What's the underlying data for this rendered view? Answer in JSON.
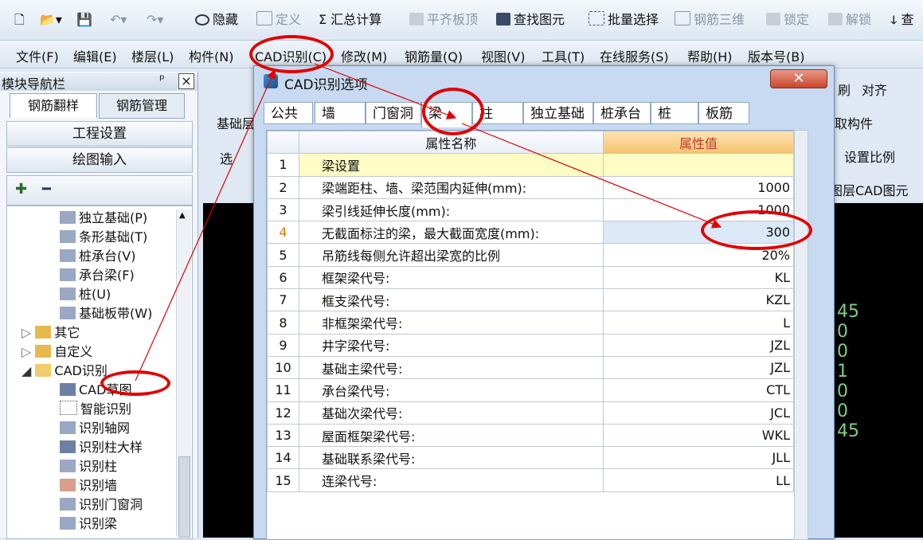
{
  "toolbar": {
    "hide_label": "隐藏",
    "define_label": "定义",
    "sum_label": "汇总计算",
    "align_top_label": "平齐板顶",
    "find_label": "查找图元",
    "batch_select_label": "批量选择",
    "rebar_3d_label": "钢筋三维",
    "lock_label": "锁定",
    "unlock_label": "解锁",
    "check_label": "查"
  },
  "menu": {
    "items": [
      "文件(F)",
      "编辑(E)",
      "楼层(L)",
      "构件(N)",
      "CAD识别(C)",
      "修改(M)",
      "钢筋量(Q)",
      "视图(V)",
      "工具(T)",
      "在线服务(S)",
      "帮助(H)",
      "版本号(B)"
    ]
  },
  "nav": {
    "title": "模块导航栏",
    "pin": "ᵖ",
    "close": "×",
    "tabs": [
      "钢筋翻样",
      "钢筋管理"
    ],
    "buttons": [
      "工程设置",
      "绘图输入"
    ],
    "expand": "✚",
    "collapse": "━",
    "tree": [
      {
        "label": "独立基础(P)"
      },
      {
        "label": "条形基础(T)"
      },
      {
        "label": "桩承台(V)"
      },
      {
        "label": "承台梁(F)"
      },
      {
        "label": "桩(U)"
      },
      {
        "label": "基础板带(W)"
      },
      {
        "label": "其它"
      },
      {
        "label": "自定义"
      },
      {
        "label": "CAD识别"
      },
      {
        "label": "CAD草图"
      },
      {
        "label": "智能识别"
      },
      {
        "label": "识别轴网"
      },
      {
        "label": "识别柱大样"
      },
      {
        "label": "识别柱"
      },
      {
        "label": "识别墙"
      },
      {
        "label": "识别门窗洞"
      },
      {
        "label": "识别梁"
      }
    ]
  },
  "background": {
    "right_labels": [
      "刷",
      "对齐",
      "取构件",
      "设置比例",
      "图层CAD图元"
    ],
    "left_labels": [
      "基础层",
      "选"
    ],
    "canvas_text": "45\n0\n0\n1\n0\n0\n45"
  },
  "dialog": {
    "title": "CAD识别选项",
    "close": "✕",
    "tabs": [
      "公共",
      "墙",
      "门窗洞",
      "梁",
      "柱",
      "独立基础",
      "桩承台",
      "桩",
      "板筋"
    ],
    "active_tab": "梁",
    "columns": {
      "name": "属性名称",
      "value": "属性值"
    },
    "rows": [
      {
        "num": "1",
        "name": "梁设置",
        "value": ""
      },
      {
        "num": "2",
        "name": "梁端距柱、墙、梁范围内延伸(mm):",
        "value": "1000"
      },
      {
        "num": "3",
        "name": "梁引线延伸长度(mm):",
        "value": "1000"
      },
      {
        "num": "4",
        "name": "无截面标注的梁，最大截面宽度(mm):",
        "value": "300"
      },
      {
        "num": "5",
        "name": "吊筋线每侧允许超出梁宽的比例",
        "value": "20%"
      },
      {
        "num": "6",
        "name": "框架梁代号:",
        "value": "KL"
      },
      {
        "num": "7",
        "name": "框支梁代号:",
        "value": "KZL"
      },
      {
        "num": "8",
        "name": "非框架梁代号:",
        "value": "L"
      },
      {
        "num": "9",
        "name": "井字梁代号:",
        "value": "JZL"
      },
      {
        "num": "10",
        "name": "基础主梁代号:",
        "value": "JZL"
      },
      {
        "num": "11",
        "name": "承台梁代号:",
        "value": "CTL"
      },
      {
        "num": "12",
        "name": "基础次梁代号:",
        "value": "JCL"
      },
      {
        "num": "13",
        "name": "屋面框架梁代号:",
        "value": "WKL"
      },
      {
        "num": "14",
        "name": "基础联系梁代号:",
        "value": "JLL"
      },
      {
        "num": "15",
        "name": "连梁代号:",
        "value": "LL"
      }
    ]
  },
  "colors": {
    "annotation_red": "#e10000",
    "section_row": "#fdfcc4",
    "value_header": "#f4c46e"
  }
}
